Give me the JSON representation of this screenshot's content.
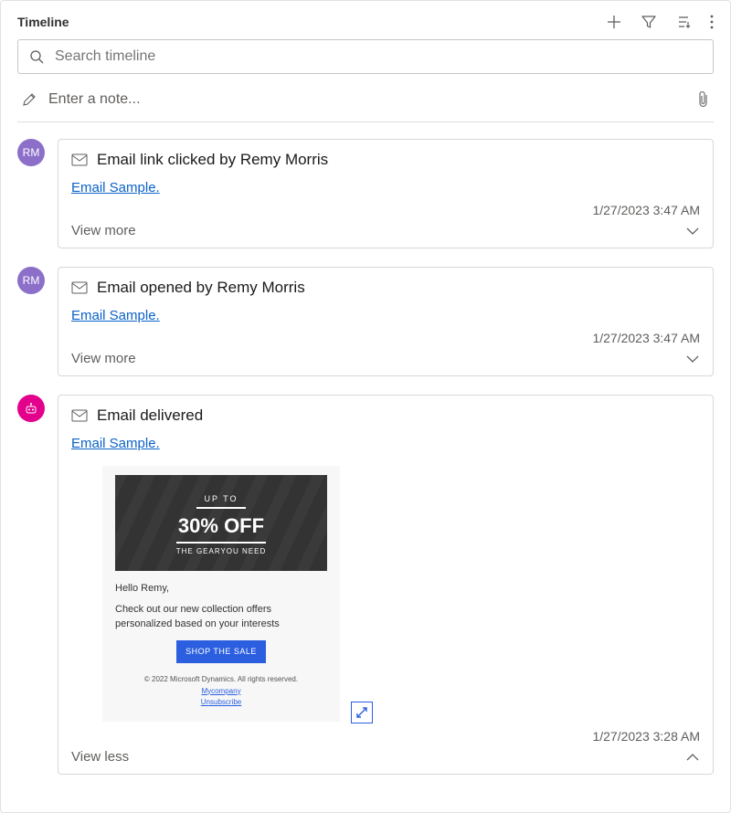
{
  "header": {
    "title": "Timeline"
  },
  "search": {
    "placeholder": "Search timeline"
  },
  "note": {
    "placeholder": "Enter a note..."
  },
  "items": [
    {
      "avatar": "RM",
      "title": "Email link clicked by Remy Morris",
      "link": "Email Sample.",
      "timestamp": "1/27/2023 3:47 AM",
      "footer": "View more"
    },
    {
      "avatar": "RM",
      "title": "Email opened by Remy Morris",
      "link": "Email Sample.",
      "timestamp": "1/27/2023 3:47 AM",
      "footer": "View more"
    },
    {
      "title": "Email delivered",
      "link": "Email Sample.",
      "timestamp": "1/27/2023 3:28 AM",
      "footer": "View less",
      "preview": {
        "upto": "UP TO",
        "pct": "30% OFF",
        "gear": "THE GEARYOU NEED",
        "hello": "Hello Remy,",
        "body": "Check out our new collection offers personalized based on your interests",
        "cta": "SHOP THE SALE",
        "copyright": "© 2022 Microsoft Dynamics. All rights reserved.",
        "company": "Mycompany",
        "unsub": "Unsubscribe"
      }
    }
  ]
}
